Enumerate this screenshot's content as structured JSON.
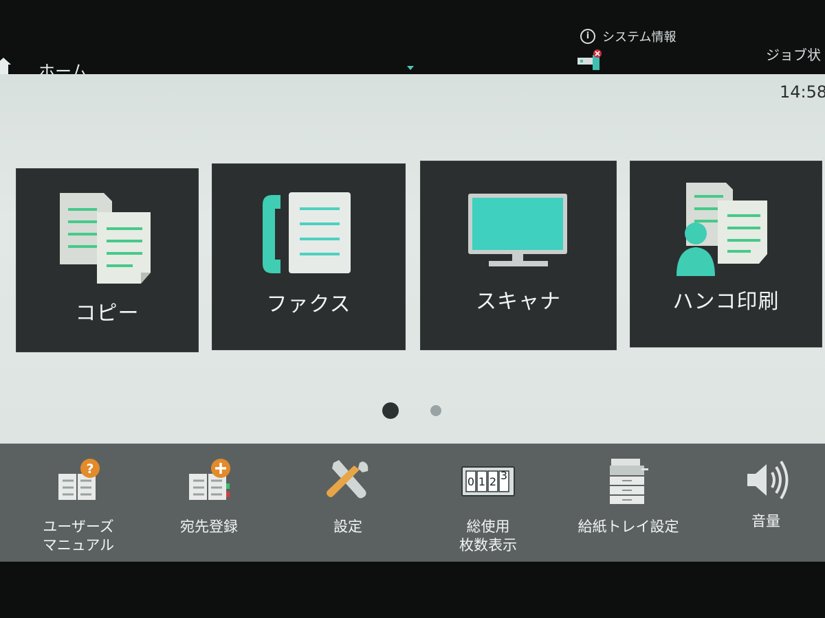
{
  "header": {
    "title": "ホーム",
    "system_info": "システム情報",
    "job_status": "ジョブ状",
    "clock": "14:58"
  },
  "apps": [
    {
      "label": "コピー",
      "icon": "copy-documents-icon"
    },
    {
      "label": "ファクス",
      "icon": "fax-phone-icon"
    },
    {
      "label": "スキャナ",
      "icon": "monitor-icon"
    },
    {
      "label": "ハンコ印刷",
      "icon": "user-documents-icon"
    }
  ],
  "pagination": {
    "current": 1,
    "total": 2
  },
  "toolbar": {
    "items": [
      {
        "line1": "ユーザーズ",
        "line2": "マニュアル",
        "icon": "manual-help-icon"
      },
      {
        "line1": "宛先登録",
        "line2": "",
        "icon": "address-add-icon"
      },
      {
        "line1": "設定",
        "line2": "",
        "icon": "settings-tools-icon"
      },
      {
        "line1": "総使用",
        "line2": "枚数表示",
        "icon": "counter-icon"
      },
      {
        "line1": "給紙トレイ設定",
        "line2": "",
        "icon": "paper-tray-icon"
      },
      {
        "line1": "音量",
        "line2": "",
        "icon": "volume-icon"
      }
    ],
    "counter_digits": "0123"
  },
  "colors": {
    "accent": "#4fd0bc",
    "tile_bg": "#2b2f2f",
    "panel_bg": "#dfe5e3",
    "toolbar_bg": "#5b6161",
    "warning_badge": "#e38a2a"
  }
}
